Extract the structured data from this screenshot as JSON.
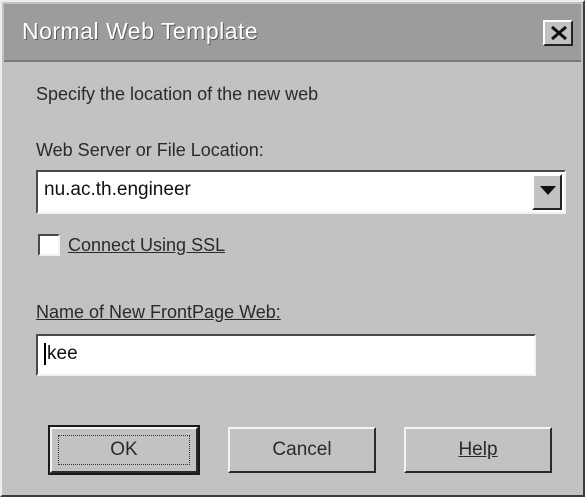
{
  "window": {
    "title": "Normal Web Template"
  },
  "instructions": "Specify the location of the new web",
  "location": {
    "label": "Web Server or File Location:",
    "value": "nu.ac.th.engineer"
  },
  "ssl": {
    "label": "Connect Using SSL",
    "checked": false
  },
  "web_name": {
    "label": "Name of New FrontPage Web:",
    "value": "kee"
  },
  "buttons": {
    "ok": "OK",
    "cancel": "Cancel",
    "help": "Help"
  }
}
